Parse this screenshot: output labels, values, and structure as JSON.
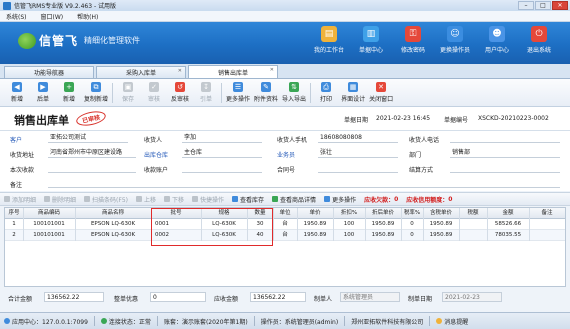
{
  "window": {
    "title": "信管飞RMS专业版 V9.2.463 - 试用版"
  },
  "menu": [
    "系统(S)",
    "窗口(W)",
    "帮助(H)"
  ],
  "brand": {
    "name": "信管飞",
    "slogan": "精细化管理软件"
  },
  "nav": [
    {
      "label": "我的工作台",
      "icon": "desk-icon",
      "color": "#f0b23a"
    },
    {
      "label": "单据中心",
      "icon": "document-icon",
      "color": "#3fa1e8"
    },
    {
      "label": "修改密码",
      "icon": "key-icon",
      "color": "#e5483a"
    },
    {
      "label": "更换操作员",
      "icon": "user-switch-icon",
      "color": "#3b8de0"
    },
    {
      "label": "用户中心",
      "icon": "user-center-icon",
      "color": "#4a94e6"
    },
    {
      "label": "退出系统",
      "icon": "power-icon",
      "color": "#e5483a"
    }
  ],
  "tabs": [
    "功能导航器",
    "采购入库单",
    "销售出库单"
  ],
  "toolbar": [
    {
      "label": "新增",
      "icon": "new-icon",
      "color": "#3f8bdc",
      "disabled": false
    },
    {
      "label": "后单",
      "icon": "next-icon",
      "color": "#3f8bdc",
      "disabled": false
    },
    {
      "label": "新增",
      "icon": "add-icon",
      "color": "#3aa655",
      "disabled": false
    },
    {
      "label": "复制新增",
      "icon": "copy-icon",
      "color": "#3f8bdc",
      "disabled": false
    },
    {
      "label": "保存",
      "icon": "save-icon",
      "color": "#3f8bdc",
      "disabled": true
    },
    {
      "label": "审核",
      "icon": "check-icon",
      "color": "#3aa655",
      "disabled": true
    },
    {
      "label": "反审核",
      "icon": "uncheck-icon",
      "color": "#e5483a",
      "disabled": false
    },
    {
      "label": "引单",
      "icon": "import-order-icon",
      "color": "#3f8bdc",
      "disabled": true
    },
    {
      "label": "更多操作",
      "icon": "more-icon",
      "color": "#3f8bdc",
      "disabled": false
    },
    {
      "label": "附件资料",
      "icon": "attachment-icon",
      "color": "#3f8bdc",
      "disabled": false
    },
    {
      "label": "导入导出",
      "icon": "import-export-icon",
      "color": "#3aa655",
      "disabled": false
    },
    {
      "label": "打印",
      "icon": "print-icon",
      "color": "#3f8bdc",
      "disabled": false
    },
    {
      "label": "界面设计",
      "icon": "design-icon",
      "color": "#3f8bdc",
      "disabled": false
    },
    {
      "label": "关闭窗口",
      "icon": "close-window-icon",
      "color": "#e5483a",
      "disabled": false
    }
  ],
  "doc": {
    "title": "销售出库单",
    "stamp": "已审核",
    "date_label": "单据日期",
    "date": "2021-02-23 16:45",
    "no_label": "单据编号",
    "no": "XSCKD-20210223-0002"
  },
  "fields": {
    "customer_label": "客户",
    "customer": "亚拓公司测试",
    "receiver_label": "收货人",
    "receiver": "李加",
    "receiver_phone_label": "收货人手机",
    "receiver_phone": "18608080808",
    "receiver_tel_label": "收货人电话",
    "receiver_tel": "",
    "address_label": "收货地址",
    "address": "河南省郑州市中原区建设路",
    "warehouse_label": "出库仓库",
    "warehouse": "主仓库",
    "clerk_label": "业务员",
    "clerk": "张壮",
    "dept_label": "部门",
    "dept": "销售部",
    "collect_label": "本次收款",
    "collect": "",
    "account_label": "收款账户",
    "account": "",
    "contract_label": "合同号",
    "contract": "",
    "settle_label": "结算方式",
    "settle": "",
    "remark_label": "备注",
    "remark": ""
  },
  "gridbar": {
    "add_row": "添加明细",
    "del_row": "删除明细",
    "scan": "扫描条码(F5)",
    "up": "上移",
    "down": "下移",
    "fast": "快捷操作",
    "stock": "查看库存",
    "detail": "查看商品详情",
    "more": "更多操作",
    "debt_label": "应收欠款：",
    "debt": "0",
    "credit_label": "应收信用额度：",
    "credit": "0"
  },
  "grid": {
    "columns": [
      "序号",
      "商品编码",
      "商品名称",
      "批号",
      "规格",
      "数量",
      "单位",
      "单价",
      "折扣%",
      "折后单价",
      "税率%",
      "含税单价",
      "税额",
      "金额",
      "备注"
    ],
    "rows": [
      [
        "1",
        "100101001",
        "EPSON LQ-630K",
        "0001",
        "LQ-630K",
        "30",
        "台",
        "1950.89",
        "100",
        "1950.89",
        "0",
        "1950.89",
        "",
        "58526.66",
        ""
      ],
      [
        "2",
        "100101001",
        "EPSON LQ-630K",
        "0002",
        "LQ-630K",
        "40",
        "台",
        "1950.89",
        "100",
        "1950.89",
        "0",
        "1950.89",
        "",
        "78035.55",
        ""
      ]
    ]
  },
  "summary": {
    "total_label": "合计金额",
    "total": "136562.22",
    "discount_label": "整单优惠",
    "discount": "0",
    "receivable_label": "应收金额",
    "receivable": "136562.22",
    "maker_label": "制单人",
    "maker": "系统管理员",
    "make_date_label": "制单日期",
    "make_date": "2021-02-23"
  },
  "status": {
    "app_center": "应用中心：127.0.0.1:7099",
    "conn": "连接状态：正常",
    "account": "账套：演示账套(2020年第1期)",
    "operator": "操作员：系统管理员(admin)",
    "company": "郑州亚拓软件科技有限公司",
    "message": "消息提醒"
  }
}
